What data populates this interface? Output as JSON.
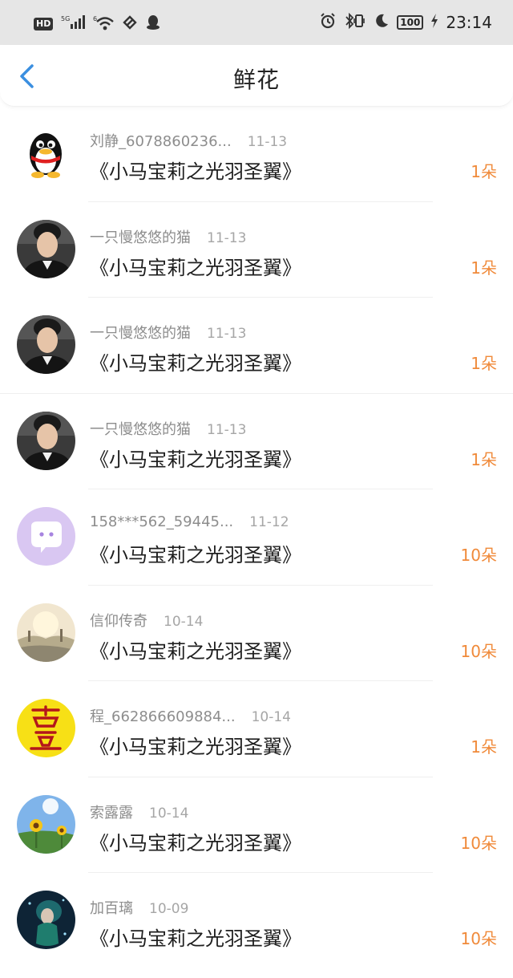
{
  "status_bar": {
    "hd": "HD",
    "net": "5G",
    "net2": "6",
    "battery": "100",
    "time": "23:14"
  },
  "header": {
    "title": "鲜花",
    "back_icon": "chevron-left-icon",
    "accent": "#3b8fe0"
  },
  "count_color": "#f08a3a",
  "items": [
    {
      "name": "刘静_6078860236...",
      "date": "11-13",
      "book": "《小马宝莉之光羽圣翼》",
      "count": "1朵",
      "avatar": "qq-penguin-avatar"
    },
    {
      "name": "一只慢悠悠的猫",
      "date": "11-13",
      "book": "《小马宝莉之光羽圣翼》",
      "count": "1朵",
      "avatar": "man-in-suit-avatar"
    },
    {
      "name": "一只慢悠悠的猫",
      "date": "11-13",
      "book": "《小马宝莉之光羽圣翼》",
      "count": "1朵",
      "avatar": "man-in-suit-avatar"
    },
    {
      "name": "一只慢悠悠的猫",
      "date": "11-13",
      "book": "《小马宝莉之光羽圣翼》",
      "count": "1朵",
      "avatar": "man-in-suit-avatar"
    },
    {
      "name": "158***562_59445...",
      "date": "11-12",
      "book": "《小马宝莉之光羽圣翼》",
      "count": "10朵",
      "avatar": "purple-chat-avatar"
    },
    {
      "name": "信仰传奇",
      "date": "10-14",
      "book": "《小马宝莉之光羽圣翼》",
      "count": "10朵",
      "avatar": "scenery-avatar"
    },
    {
      "name": "程_662866609884...",
      "date": "10-14",
      "book": "《小马宝莉之光羽圣翼》",
      "count": "1朵",
      "avatar": "yellow-talisman-avatar"
    },
    {
      "name": "索露露",
      "date": "10-14",
      "book": "《小马宝莉之光羽圣翼》",
      "count": "10朵",
      "avatar": "sunflower-avatar"
    },
    {
      "name": "加百璃",
      "date": "10-09",
      "book": "《小马宝莉之光羽圣翼》",
      "count": "10朵",
      "avatar": "mermaid-avatar"
    }
  ]
}
